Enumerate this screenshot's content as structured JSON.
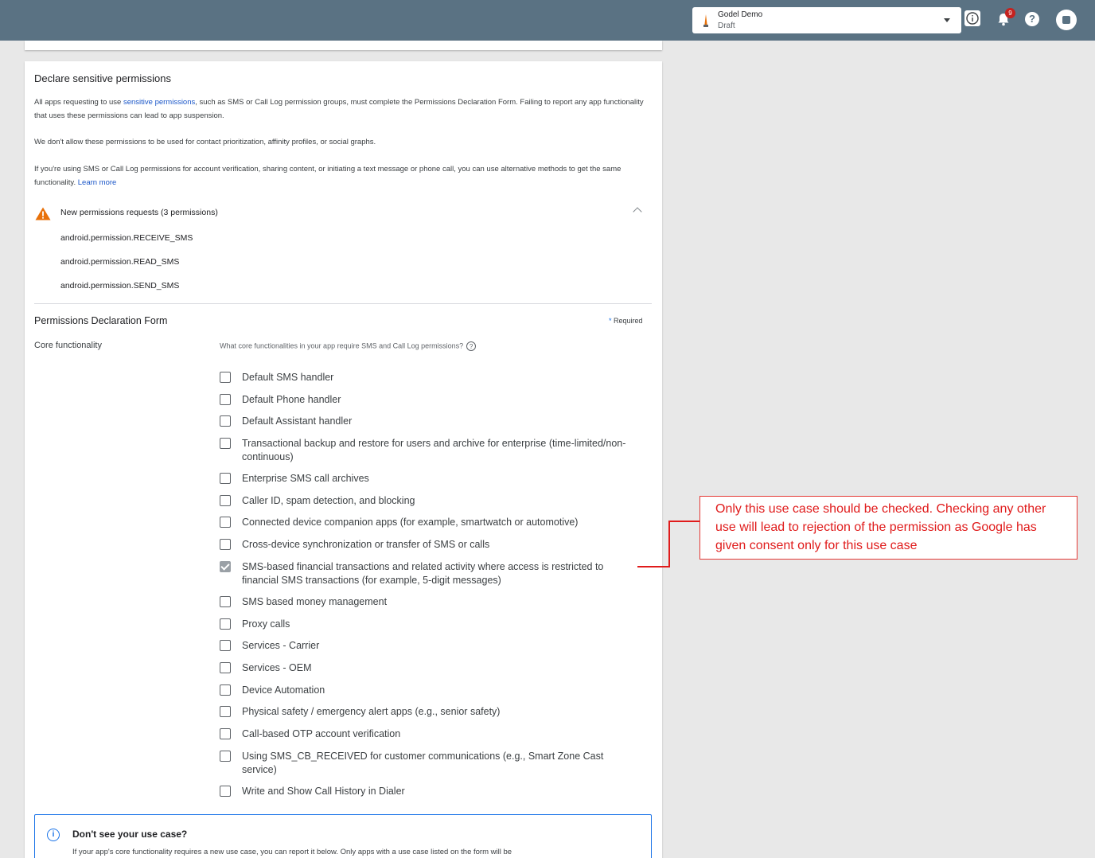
{
  "header": {
    "app_name": "Godel Demo",
    "app_status": "Draft",
    "notification_count": "9",
    "help_glyph": "?"
  },
  "section": {
    "title": "Declare sensitive permissions",
    "para1_pre": "All apps requesting to use ",
    "para1_link": "sensitive permissions",
    "para1_post": ", such as SMS or Call Log permission groups, must complete the Permissions Declaration Form. Failing to report any app functionality that uses these permissions can lead to app suspension.",
    "para2": "We don't allow these permissions to be used for contact prioritization, affinity profiles, or social graphs.",
    "para3": "If you're using SMS or Call Log permissions for account verification, sharing content, or initiating a text message or phone call, you can use alternative methods to get the same functionality.",
    "para3_link": "Learn more"
  },
  "permissions": {
    "header": "New permissions requests (3 permissions)",
    "items": [
      "android.permission.RECEIVE_SMS",
      "android.permission.READ_SMS",
      "android.permission.SEND_SMS"
    ]
  },
  "form": {
    "title": "Permissions Declaration Form",
    "required_star": "*",
    "required_label": "Required",
    "core_label": "Core functionality",
    "core_question": "What core functionalities in your app require SMS and Call Log permissions?",
    "options": [
      {
        "label": "Default SMS handler",
        "checked": false
      },
      {
        "label": "Default Phone handler",
        "checked": false
      },
      {
        "label": "Default Assistant handler",
        "checked": false
      },
      {
        "label": "Transactional backup and restore for users and archive for enterprise (time-limited/non-continuous)",
        "checked": false
      },
      {
        "label": "Enterprise SMS call archives",
        "checked": false
      },
      {
        "label": "Caller ID, spam detection, and blocking",
        "checked": false
      },
      {
        "label": "Connected device companion apps (for example, smartwatch or automotive)",
        "checked": false
      },
      {
        "label": "Cross-device synchronization or transfer of SMS or calls",
        "checked": false
      },
      {
        "label": "SMS-based financial transactions and related activity where access is restricted to financial SMS transactions (for example, 5-digit messages)",
        "checked": true
      },
      {
        "label": "SMS based money management",
        "checked": false
      },
      {
        "label": "Proxy calls",
        "checked": false
      },
      {
        "label": "Services - Carrier",
        "checked": false
      },
      {
        "label": "Services - OEM",
        "checked": false
      },
      {
        "label": "Device Automation",
        "checked": false
      },
      {
        "label": "Physical safety / emergency alert apps (e.g., senior safety)",
        "checked": false
      },
      {
        "label": "Call-based OTP account verification",
        "checked": false
      },
      {
        "label": "Using SMS_CB_RECEIVED for customer communications (e.g., Smart Zone Cast service)",
        "checked": false
      },
      {
        "label": "Write and Show Call History in Dialer",
        "checked": false
      }
    ]
  },
  "use_case_box": {
    "title": "Don't see your use case?",
    "body": "If your app's core functionality requires a new use case, you can report it below. Only apps with a use case listed on the form will be"
  },
  "annotation": {
    "text": "Only this use case should be checked. Checking any other use will lead to rejection of the permission as Google has given consent only for this use case"
  },
  "colors": {
    "topbar": "#5a7283",
    "link": "#1a56c8",
    "warning": "#e8710a",
    "annotation": "#e01b1b",
    "info_accent": "#1a73e8"
  }
}
